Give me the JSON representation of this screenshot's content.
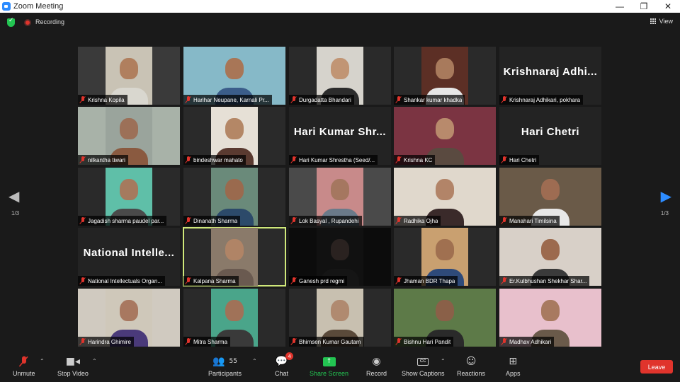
{
  "window": {
    "title": "Zoom Meeting",
    "minimize": "—",
    "maximize": "❐",
    "close": "✕"
  },
  "topbar": {
    "recording_label": "Recording",
    "view_label": "View"
  },
  "pager": {
    "left": "1/3",
    "right": "1/3"
  },
  "tiles": [
    {
      "name": "Krishna Kopila",
      "bg": "#3a3a3a",
      "wall": "#c9c3b5",
      "skin": "#b07f5e",
      "shirt": "#d9d7cf"
    },
    {
      "name": "Harihar Neupane, Karnali Pr...",
      "bg": "#7aa8b8",
      "wall": "#86b9c8",
      "skin": "#a87657",
      "shirt": "#3b5d8a"
    },
    {
      "name": "Durgadatta Bhandari",
      "bg": "#2a2a2a",
      "wall": "#d6d3cc",
      "skin": "#c19574",
      "shirt": "#2c2c2c"
    },
    {
      "name": "Shankar kumar khadka",
      "bg": "#2a2a2a",
      "wall": "#5c2f25",
      "skin": "#a87a5c",
      "shirt": "#e6e6e6"
    },
    {
      "name": "Krishnaraj Adhikari, pokhara",
      "display_name": "Krishnaraj  Adhi..."
    },
    {
      "name": "nilkantha tiwari",
      "bg": "#a8b2a8",
      "wall": "#9aa49c",
      "skin": "#9c7058",
      "shirt": "#8a5a40"
    },
    {
      "name": "bindeshwar mahato",
      "bg": "#2a2a2a",
      "wall": "#e6e0d6",
      "skin": "#b48766",
      "shirt": "#5a3a30"
    },
    {
      "name": "Hari Kumar Shrestha (Seed/...",
      "display_name": "Hari  Kumar  Shr..."
    },
    {
      "name": "Krishna KC",
      "bg": "#6e2a34",
      "wall": "#7b3442",
      "skin": "#b88a6c",
      "shirt": "#5a4a40"
    },
    {
      "name": "Hari Chetri",
      "display_name": "Hari  Chetri"
    },
    {
      "name": "Jagadish sharma paudel par...",
      "bg": "#2a2a2a",
      "wall": "#5fbfa8",
      "skin": "#a57a5e",
      "shirt": "#4a4a4a"
    },
    {
      "name": "Dinanath Sharma",
      "bg": "#2a2a2a",
      "wall": "#6a8a7a",
      "skin": "#9a6a4e",
      "shirt": "#2c4a6a"
    },
    {
      "name": "Lok Basyal , Rupandehi",
      "bg": "#4a4a4a",
      "wall": "#c88a8a",
      "skin": "#a57760",
      "shirt": "#6a7a8a"
    },
    {
      "name": "Radhika Ojha",
      "bg": "#d6d0c8",
      "wall": "#e0d8cc",
      "skin": "#b28468",
      "shirt": "#3a2a2a"
    },
    {
      "name": "Manahari Timilsina",
      "bg": "#5a4a3a",
      "wall": "#6a5a48",
      "skin": "#9e6c52",
      "shirt": "#e8e8e8"
    },
    {
      "name": "National Intellectuals Organ...",
      "display_name": "National  Intelle..."
    },
    {
      "name": "Kalpana Sharma",
      "bg": "#2a2a2a",
      "wall": "#8a7a6a",
      "skin": "#b08466",
      "shirt": "#6a5a50",
      "active": true
    },
    {
      "name": "Ganesh prd regmi",
      "bg": "#0c0c0c",
      "wall": "#111111",
      "skin": "#2a2220",
      "shirt": "#151515"
    },
    {
      "name": "Jhaman BDR Thapa",
      "bg": "#2a2a2a",
      "wall": "#c9a070",
      "skin": "#a07050",
      "shirt": "#2e4a7a"
    },
    {
      "name": "Er.Kulbhushan Shekhar Shar...",
      "bg": "#c8c0b8",
      "wall": "#d8d0c8",
      "skin": "#9c6a4e",
      "shirt": "#3a3a3a"
    },
    {
      "name": "Harindra Ghimire",
      "bg": "#d0cac0",
      "wall": "#cfc8ba",
      "skin": "#a87860",
      "shirt": "#4a3a7a"
    },
    {
      "name": "Mitra Sharma",
      "bg": "#2a2a2a",
      "wall": "#4aa58a",
      "skin": "#a07258",
      "shirt": "#3a3a3a"
    },
    {
      "name": "Bhimsen Kumar Gautam",
      "bg": "#2a2a2a",
      "wall": "#c8c0b0",
      "skin": "#b08a70",
      "shirt": "#5a4a3a"
    },
    {
      "name": "Bishnu Hari Pandit",
      "bg": "#4a6a3a",
      "wall": "#5d7a48",
      "skin": "#8a6048",
      "shirt": "#2a2a2a"
    },
    {
      "name": "Madhav Adhikari",
      "bg": "#e6b8c8",
      "wall": "#e8c0cc",
      "skin": "#a87a60",
      "shirt": "#6a5a4a"
    }
  ],
  "toolbar": {
    "unmute": "Unmute",
    "stop_video": "Stop Video",
    "participants": "Participants",
    "participants_count": "55",
    "chat": "Chat",
    "chat_badge": "4",
    "share_screen": "Share Screen",
    "record": "Record",
    "show_captions": "Show Captions",
    "cc_icon": "CC",
    "reactions": "Reactions",
    "apps": "Apps",
    "leave": "Leave"
  }
}
